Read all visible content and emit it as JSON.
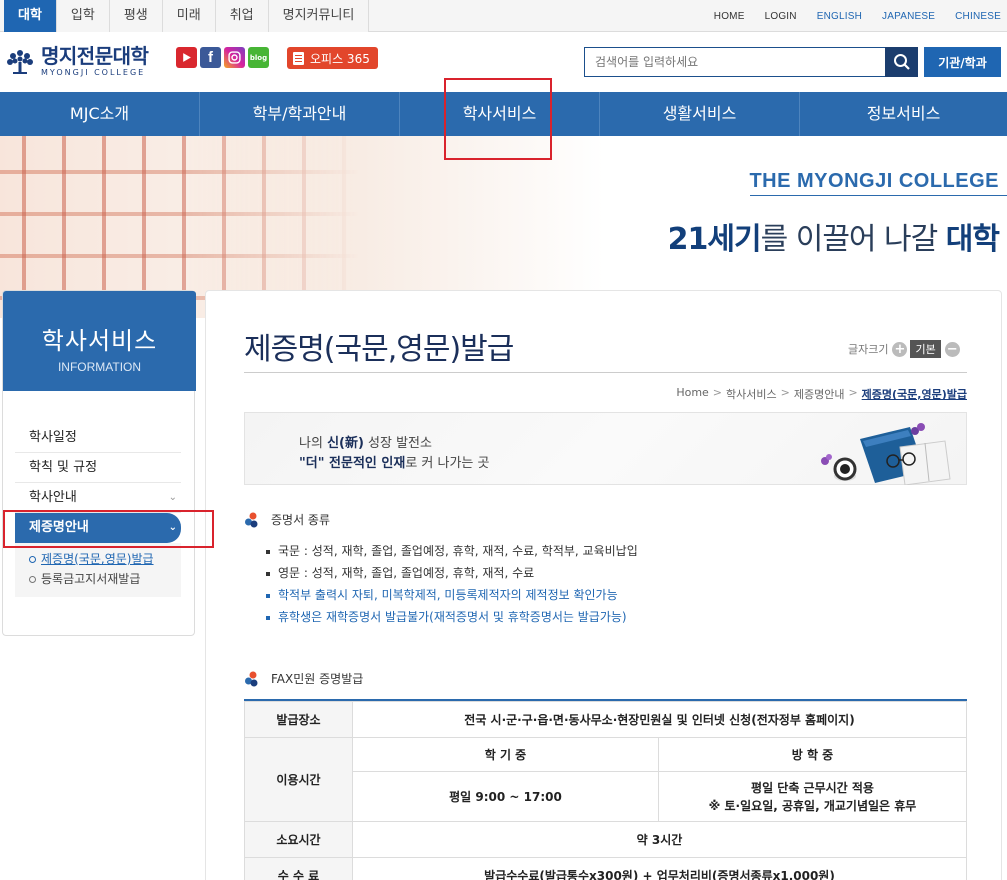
{
  "top_tabs": [
    {
      "label": "대학",
      "active": true
    },
    {
      "label": "입학"
    },
    {
      "label": "평생"
    },
    {
      "label": "미래"
    },
    {
      "label": "취업"
    },
    {
      "label": "명지커뮤니티"
    }
  ],
  "top_links": [
    "HOME",
    "LOGIN",
    "ENGLISH",
    "JAPANESE",
    "CHINESE"
  ],
  "logo": {
    "ko": "명지전문대학",
    "en": "MYONGJI COLLEGE"
  },
  "sns": {
    "blog": "blog"
  },
  "office_label": "오피스 365",
  "search": {
    "placeholder": "검색어를 입력하세요"
  },
  "inst_button": "기관/학과",
  "gnb": [
    "MJC소개",
    "학부/학과안내",
    "학사서비스",
    "생활서비스",
    "정보서비스"
  ],
  "banner": {
    "en": "THE MYONGJI COLLEGE",
    "ko_bold1": "21세기",
    "ko_mid": "를 이끌어 나갈 ",
    "ko_bold2": "대학"
  },
  "side": {
    "title": "학사서비스",
    "subtitle": "INFORMATION",
    "items": [
      "학사일정",
      "학칙 및 규정",
      "학사안내",
      "제증명안내"
    ],
    "sub_items": [
      "제증명(국문,영문)발급",
      "등록금고지서재발급"
    ]
  },
  "page": {
    "title": "제증명(국문,영문)발급",
    "fontsize_label": "글자크기",
    "fontsize_plus": "+",
    "fontsize_basic": "기본",
    "fontsize_minus": "−",
    "breadcrumb": [
      "Home",
      "학사서비스",
      "제증명안내",
      "제증명(국문,영문)발급"
    ],
    "slogan": {
      "l1a": "나의 ",
      "l1b": "신(新)",
      "l1c": " 성장 발전소",
      "l2a": "\"더\" 전문적인 인재",
      "l2b": "로 커 나가는 곳"
    }
  },
  "section1": {
    "title": "증명서 종류",
    "bullets": [
      "국문 : 성적, 재학, 졸업, 졸업예정, 휴학, 재적, 수료, 학적부, 교육비납입",
      "영문 : 성적, 재학, 졸업, 졸업예정, 휴학, 재적, 수료",
      "학적부 출력시 자퇴, 미복학제적, 미등록제적자의 제적정보 확인가능",
      "휴학생은 재학증명서 발급불가(재적증명서 및 휴학증명서는 발급가능)"
    ]
  },
  "section2": {
    "title": "FAX민원 증명발급",
    "table": {
      "place_label": "발급장소",
      "place_value": "전국 시·군·구·읍·면·동사무소·현장민원실 및 인터넷 신청(전자정부 홈페이지)",
      "hours_label": "이용시간",
      "semester": "학 기 중",
      "vacation": "방 학 중",
      "semester_hours": "평일 9:00 ~ 17:00",
      "vacation_hours1": "평일 단축 근무시간 적용",
      "vacation_hours2": "※ 토·일요일, 공휴일, 개교기념일은 휴무",
      "duration_label": "소요시간",
      "duration_value": "약 3시간",
      "fee_label": "수 수 료",
      "fee_value": "발급수수료(발급통수x300원) + 업무처리비(증명서종류x1,000원)"
    }
  },
  "colors": {
    "primary": "#2b6aad",
    "dark": "#1b3d7c",
    "highlight": "#d9232d"
  }
}
